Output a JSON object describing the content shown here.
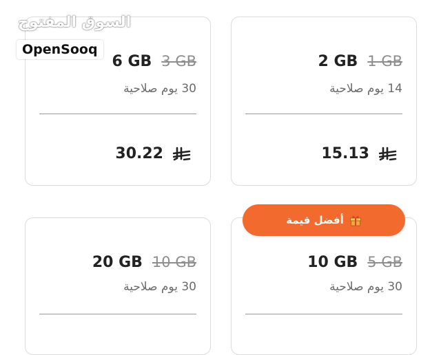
{
  "watermark": {
    "arabic": "السوق المفتوح",
    "latin": "OpenSooq"
  },
  "badge": {
    "label": "أفضل قيمة",
    "icon": "gift-icon",
    "color": "#f26a2e"
  },
  "currency_icon": "saudi-riyal-icon",
  "plans": [
    {
      "new_size": "6 GB",
      "old_size": "3 GB",
      "validity": "30 يوم صلاحية",
      "price": "30.22"
    },
    {
      "new_size": "2 GB",
      "old_size": "1 GB",
      "validity": "14 يوم صلاحية",
      "price": "15.13"
    },
    {
      "new_size": "20 GB",
      "old_size": "10 GB",
      "validity": "30 يوم صلاحية",
      "price": ""
    },
    {
      "new_size": "10 GB",
      "old_size": "5 GB",
      "validity": "30 يوم صلاحية",
      "price": ""
    }
  ]
}
